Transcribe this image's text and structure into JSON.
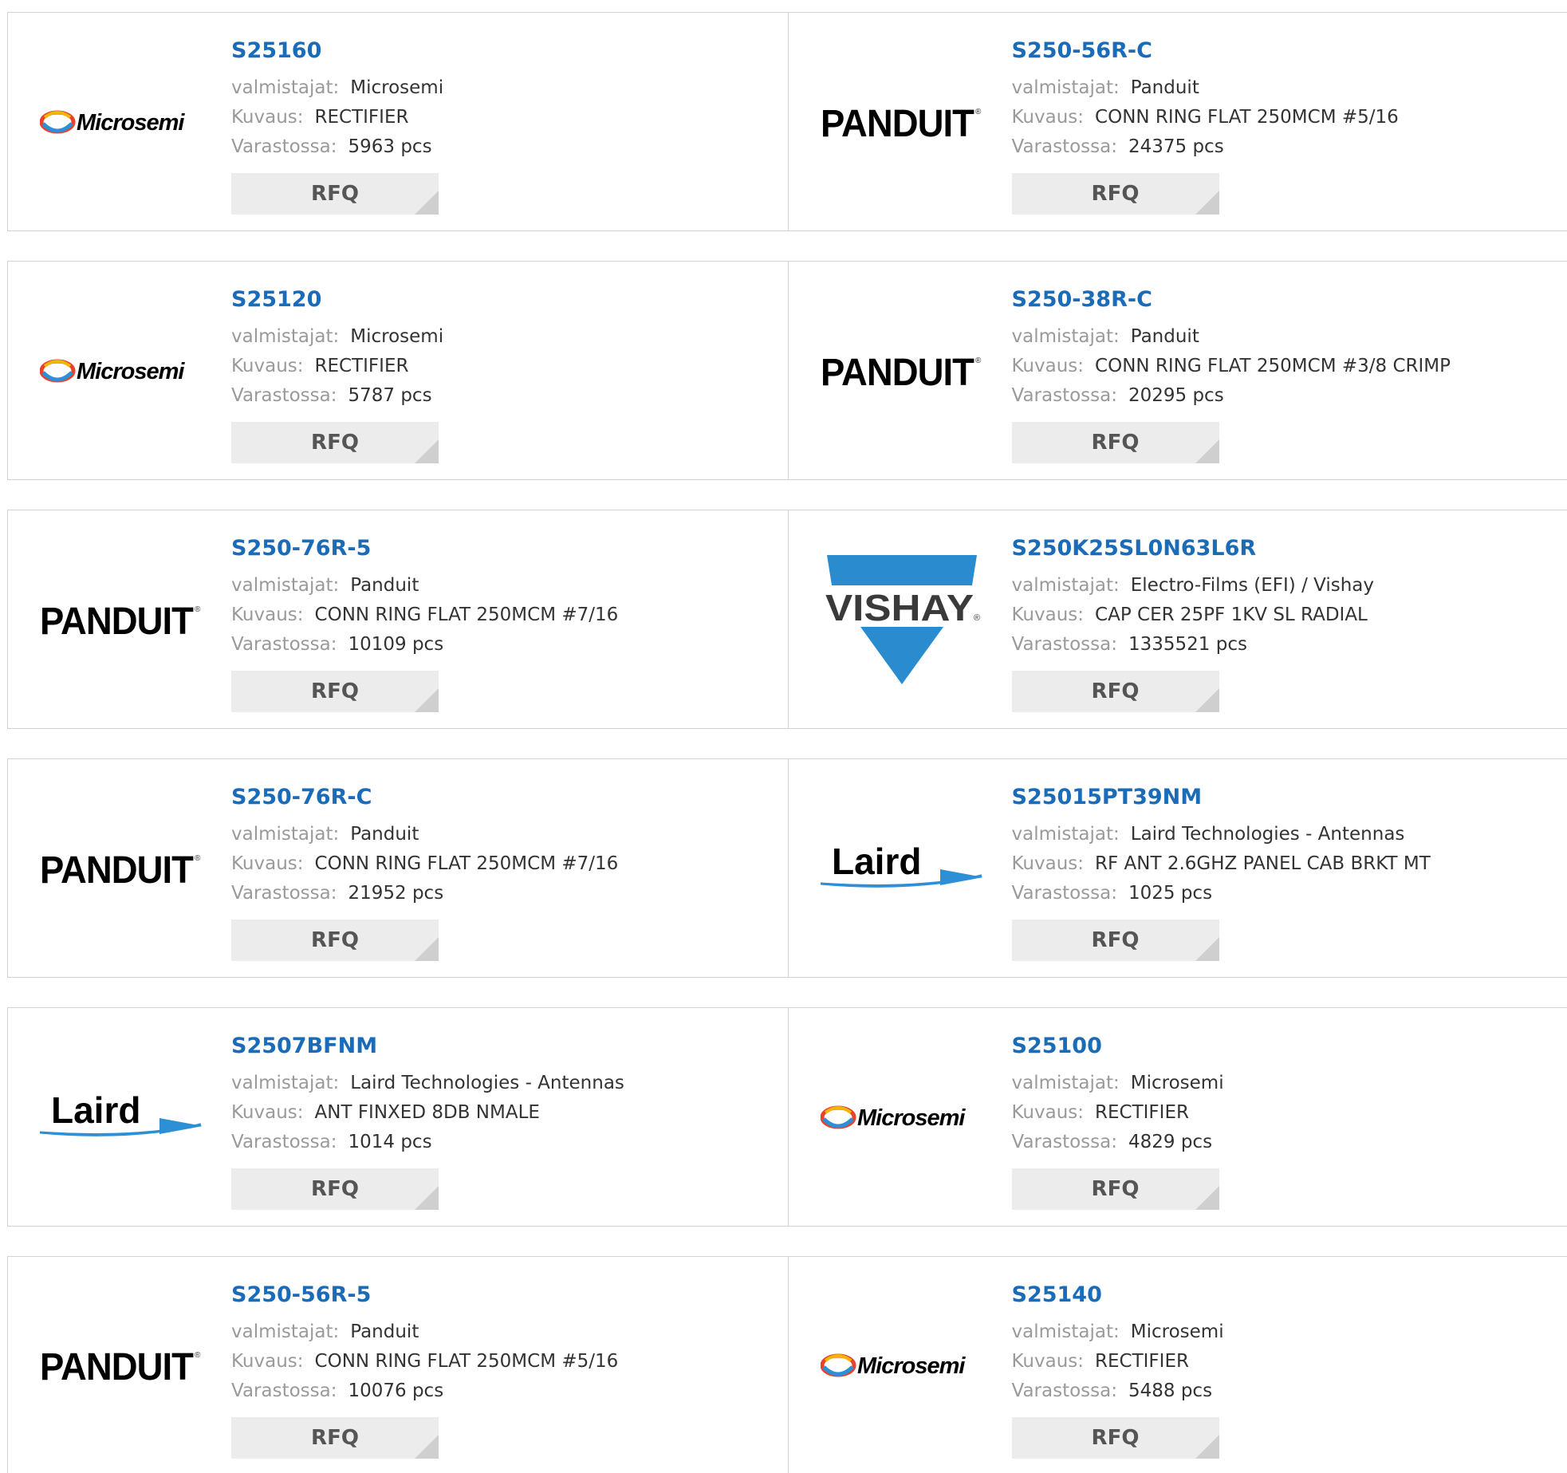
{
  "labels": {
    "manufacturer": "valmistajat:",
    "description": "Kuvaus:",
    "stock": "Varastossa:",
    "rfq": "RFQ"
  },
  "logos": {
    "microsemi": "Microsemi",
    "panduit": "PANDUIT",
    "vishay": "VISHAY",
    "laird": "Laird"
  },
  "colors": {
    "part_number": "#1a6bb8",
    "label": "#9a9a9a",
    "value": "#333333",
    "rfq_bg": "#ececec",
    "border": "#d2d2d2",
    "vishay_blue": "#2a8ccf"
  },
  "products": [
    {
      "part": "S25160",
      "manufacturer": "Microsemi",
      "description": "RECTIFIER",
      "stock": "5963 pcs",
      "logo": "microsemi"
    },
    {
      "part": "S250-56R-C",
      "manufacturer": "Panduit",
      "description": "CONN RING FLAT 250MCM #5/16",
      "stock": "24375 pcs",
      "logo": "panduit"
    },
    {
      "part": "S25120",
      "manufacturer": "Microsemi",
      "description": "RECTIFIER",
      "stock": "5787 pcs",
      "logo": "microsemi"
    },
    {
      "part": "S250-38R-C",
      "manufacturer": "Panduit",
      "description": "CONN RING FLAT 250MCM #3/8 CRIMP",
      "stock": "20295 pcs",
      "logo": "panduit"
    },
    {
      "part": "S250-76R-5",
      "manufacturer": "Panduit",
      "description": "CONN RING FLAT 250MCM #7/16",
      "stock": "10109 pcs",
      "logo": "panduit"
    },
    {
      "part": "S250K25SL0N63L6R",
      "manufacturer": "Electro-Films (EFI) / Vishay",
      "description": "CAP CER 25PF 1KV SL RADIAL",
      "stock": "1335521 pcs",
      "logo": "vishay"
    },
    {
      "part": "S250-76R-C",
      "manufacturer": "Panduit",
      "description": "CONN RING FLAT 250MCM #7/16",
      "stock": "21952 pcs",
      "logo": "panduit"
    },
    {
      "part": "S25015PT39NM",
      "manufacturer": "Laird Technologies - Antennas",
      "description": "RF ANT 2.6GHZ PANEL CAB BRKT MT",
      "stock": "1025 pcs",
      "logo": "laird"
    },
    {
      "part": "S2507BFNM",
      "manufacturer": "Laird Technologies - Antennas",
      "description": "ANT FINXED 8DB NMALE",
      "stock": "1014 pcs",
      "logo": "laird"
    },
    {
      "part": "S25100",
      "manufacturer": "Microsemi",
      "description": "RECTIFIER",
      "stock": "4829 pcs",
      "logo": "microsemi"
    },
    {
      "part": "S250-56R-5",
      "manufacturer": "Panduit",
      "description": "CONN RING FLAT 250MCM #5/16",
      "stock": "10076 pcs",
      "logo": "panduit"
    },
    {
      "part": "S25140",
      "manufacturer": "Microsemi",
      "description": "RECTIFIER",
      "stock": "5488 pcs",
      "logo": "microsemi"
    }
  ]
}
